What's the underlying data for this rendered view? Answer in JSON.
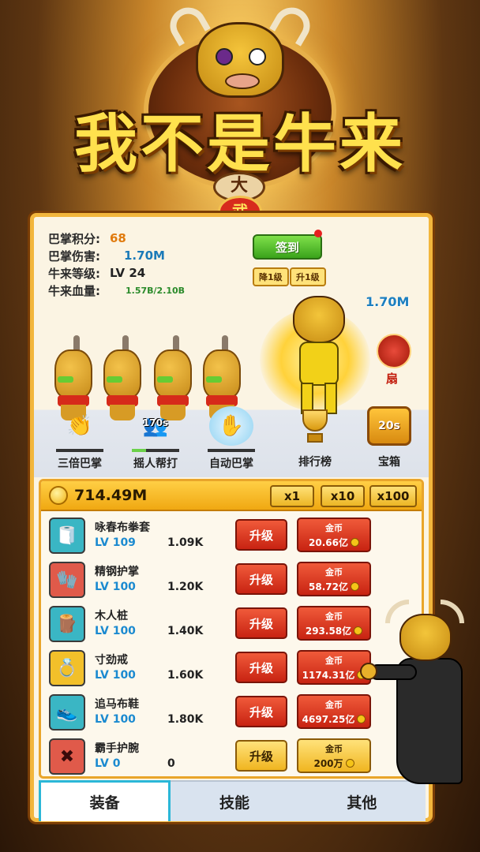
{
  "game": {
    "title": "我不是牛来",
    "seal": "武",
    "medal": "大"
  },
  "stats": [
    {
      "label": "巴掌积分:",
      "value": "68"
    },
    {
      "label": "巴掌伤害:",
      "value": "1.70M"
    },
    {
      "label": "牛来等级:",
      "value": "LV  24"
    },
    {
      "label": "牛来血量:",
      "value": "1.57B/2.10B"
    }
  ],
  "actions": {
    "checkin": "签到",
    "down_level": "降1级",
    "up_level": "升1级"
  },
  "arena": {
    "damage_float": "1.70M",
    "slap_label": "扇"
  },
  "skills": [
    {
      "label": "三倍巴掌",
      "timer": "",
      "progress": 0
    },
    {
      "label": "摇人帮打",
      "timer": "170s",
      "progress": 0.3
    },
    {
      "label": "自动巴掌",
      "timer": "",
      "progress": 0
    },
    {
      "label": "排行榜"
    },
    {
      "label": "宝箱",
      "timer": "20s"
    }
  ],
  "wallet": {
    "coins": "714.49M",
    "multipliers": [
      "x1",
      "x10",
      "x100"
    ]
  },
  "equipment": [
    {
      "name": "咏春布拳套",
      "level": "LV 109",
      "damage": "1.09K",
      "upgrade": "升级",
      "cost_label": "金币",
      "cost": "20.66亿",
      "affordable": false,
      "icon": "wrap-icon"
    },
    {
      "name": "精钢护掌",
      "level": "LV 100",
      "damage": "1.20K",
      "upgrade": "升级",
      "cost_label": "金币",
      "cost": "58.72亿",
      "affordable": false,
      "icon": "gauntlet-icon"
    },
    {
      "name": "木人桩",
      "level": "LV 100",
      "damage": "1.40K",
      "upgrade": "升级",
      "cost_label": "金币",
      "cost": "293.58亿",
      "affordable": false,
      "icon": "wooden-dummy-icon"
    },
    {
      "name": "寸劲戒",
      "level": "LV 100",
      "damage": "1.60K",
      "upgrade": "升级",
      "cost_label": "金币",
      "cost": "1174.31亿",
      "affordable": false,
      "icon": "ring-icon"
    },
    {
      "name": "追马布鞋",
      "level": "LV 100",
      "damage": "1.80K",
      "upgrade": "升级",
      "cost_label": "金币",
      "cost": "4697.25亿",
      "affordable": false,
      "icon": "shoe-icon"
    },
    {
      "name": "霸手护腕",
      "level": "LV 0",
      "damage": "0",
      "upgrade": "升级",
      "cost_label": "金币",
      "cost": "200万",
      "affordable": true,
      "icon": "wristguard-icon"
    }
  ],
  "tabs": [
    {
      "label": "装备"
    },
    {
      "label": "技能"
    },
    {
      "label": "其他"
    }
  ]
}
